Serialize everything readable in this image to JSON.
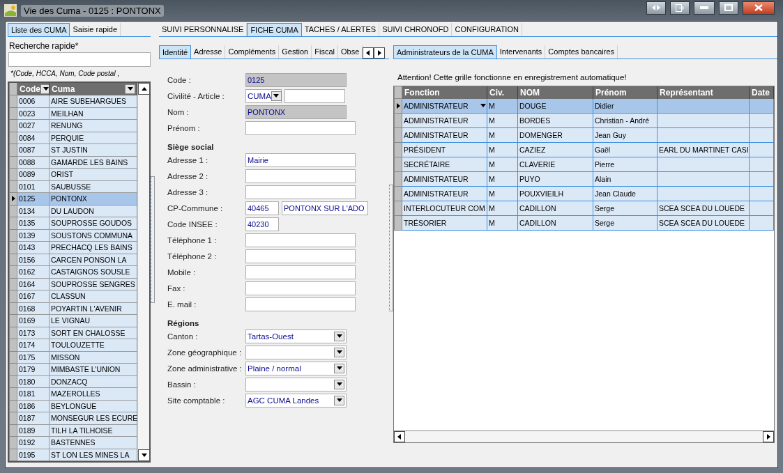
{
  "window": {
    "title": "Vie des Cuma - 0125 : PONTONX"
  },
  "left_tabs": [
    {
      "label": "Liste des CUMA",
      "selected": true
    },
    {
      "label": "Saisie rapide",
      "selected": false
    }
  ],
  "quick_search": {
    "label": "Recherche rapide*",
    "hint": "*(Code, HCCA, Nom, Code postal ,"
  },
  "cuma_list": {
    "columns": [
      "Code",
      "Cuma"
    ],
    "rows": [
      {
        "code": "0006",
        "name": "AIRE SUBEHARGUES",
        "selected": false
      },
      {
        "code": "0023",
        "name": "MEILHAN",
        "selected": false
      },
      {
        "code": "0027",
        "name": "RENUNG",
        "selected": false
      },
      {
        "code": "0084",
        "name": "PERQUIE",
        "selected": false
      },
      {
        "code": "0087",
        "name": "ST JUSTIN",
        "selected": false
      },
      {
        "code": "0088",
        "name": "GAMARDE LES BAINS",
        "selected": false
      },
      {
        "code": "0089",
        "name": "ORIST",
        "selected": false
      },
      {
        "code": "0101",
        "name": "SAUBUSSE",
        "selected": false
      },
      {
        "code": "0125",
        "name": "PONTONX",
        "selected": true
      },
      {
        "code": "0134",
        "name": "DU LAUDON",
        "selected": false
      },
      {
        "code": "0135",
        "name": "SOUPROSSE GOUDOS",
        "selected": false
      },
      {
        "code": "0139",
        "name": "SOUSTONS COMMUNA",
        "selected": false
      },
      {
        "code": "0143",
        "name": "PRECHACQ LES BAINS",
        "selected": false
      },
      {
        "code": "0156",
        "name": "CARCEN PONSON LA",
        "selected": false
      },
      {
        "code": "0162",
        "name": "CASTAIGNOS SOUSLE",
        "selected": false
      },
      {
        "code": "0164",
        "name": "SOUPROSSE SENGRES",
        "selected": false
      },
      {
        "code": "0167",
        "name": "CLASSUN",
        "selected": false
      },
      {
        "code": "0168",
        "name": "POYARTIN L'AVENIR",
        "selected": false
      },
      {
        "code": "0169",
        "name": "LE VIGNAU",
        "selected": false
      },
      {
        "code": "0173",
        "name": "SORT EN CHALOSSE",
        "selected": false
      },
      {
        "code": "0174",
        "name": "TOULOUZETTE",
        "selected": false
      },
      {
        "code": "0175",
        "name": "MISSON",
        "selected": false
      },
      {
        "code": "0179",
        "name": "MIMBASTE L'UNION",
        "selected": false
      },
      {
        "code": "0180",
        "name": "DONZACQ",
        "selected": false
      },
      {
        "code": "0181",
        "name": "MAZEROLLES",
        "selected": false
      },
      {
        "code": "0186",
        "name": "BEYLONGUE",
        "selected": false
      },
      {
        "code": "0187",
        "name": "MONSEGUR LES ECURE",
        "selected": false
      },
      {
        "code": "0189",
        "name": "TILH LA TILHOISE",
        "selected": false
      },
      {
        "code": "0192",
        "name": "BASTENNES",
        "selected": false
      },
      {
        "code": "0195",
        "name": "ST LON LES MINES LA",
        "selected": false
      }
    ]
  },
  "main_tabs": [
    {
      "label": "SUIVI PERSONNALISE",
      "selected": false
    },
    {
      "label": "FICHE CUMA",
      "selected": true
    },
    {
      "label": "TACHES / ALERTES",
      "selected": false
    },
    {
      "label": "SUIVI CHRONOFD",
      "selected": false
    },
    {
      "label": "CONFIGURATION",
      "selected": false
    }
  ],
  "form_tabs": [
    {
      "label": "Identité",
      "selected": true
    },
    {
      "label": "Adresse",
      "selected": false
    },
    {
      "label": "Compléments",
      "selected": false
    },
    {
      "label": "Gestion",
      "selected": false
    },
    {
      "label": "Fiscal",
      "selected": false
    },
    {
      "label": "Obse",
      "selected": false
    }
  ],
  "form": [
    {
      "kind": "readonly",
      "label": "Code :",
      "value": "0125"
    },
    {
      "kind": "article",
      "label": "Civilité - Article :",
      "value": "CUMA"
    },
    {
      "kind": "readonly",
      "label": "Nom :",
      "value": "PONTONX"
    },
    {
      "kind": "text",
      "label": "Prénom :"
    },
    {
      "kind": "heading",
      "label": "Siège social"
    },
    {
      "kind": "text",
      "label": "Adresse 1 :",
      "value": "Mairie"
    },
    {
      "kind": "text",
      "label": "Adresse 2 :"
    },
    {
      "kind": "text",
      "label": "Adresse 3 :"
    },
    {
      "kind": "pair",
      "label": "CP-Commune :",
      "value": "40465",
      "value2": "PONTONX SUR L'ADO"
    },
    {
      "kind": "short",
      "label": "Code INSEE :",
      "value": "40230"
    },
    {
      "kind": "text",
      "label": "Téléphone 1 :"
    },
    {
      "kind": "text",
      "label": "Téléphone 2 :"
    },
    {
      "kind": "text",
      "label": "Mobile :"
    },
    {
      "kind": "text",
      "label": "Fax :"
    },
    {
      "kind": "text",
      "label": "E. mail :"
    },
    {
      "kind": "heading",
      "label": "Régions"
    },
    {
      "kind": "combo",
      "label": "Canton :",
      "value": "Tartas-Ouest"
    },
    {
      "kind": "combo",
      "label": "Zone géographique :"
    },
    {
      "kind": "combo",
      "label": "Zone administrative :",
      "value": "Plaine / normal"
    },
    {
      "kind": "combo",
      "label": "Bassin :"
    },
    {
      "kind": "combo",
      "label": "Site comptable :",
      "value": "AGC CUMA Landes"
    }
  ],
  "right_tabs": [
    {
      "label": "Administrateurs de la CUMA",
      "selected": true
    },
    {
      "label": "Intervenants",
      "selected": false
    },
    {
      "label": "Comptes bancaires",
      "selected": false
    }
  ],
  "notice": "Attention! Cette grille fonctionne en enregistrement automatique!",
  "admins": {
    "columns": [
      "Fonction",
      "Civ.",
      "NOM",
      "Prénom",
      "Représentant",
      "Date"
    ],
    "rows": [
      {
        "cells": [
          "ADMINISTRATEUR",
          "M",
          "DOUGE",
          "Didier",
          ""
        ],
        "selected": true
      },
      {
        "cells": [
          "ADMINISTRATEUR",
          "M",
          "BORDES",
          "Christian - André",
          ""
        ],
        "selected": false
      },
      {
        "cells": [
          "ADMINISTRATEUR",
          "M",
          "DOMENGER",
          "Jean Guy",
          ""
        ],
        "selected": false
      },
      {
        "cells": [
          "PRÉSIDENT",
          "M",
          "CAZIEZ",
          "Gaël",
          "EARL DU MARTINET CASI"
        ],
        "selected": false
      },
      {
        "cells": [
          "SECRÉTAIRE",
          "M",
          "CLAVERIE",
          "Pierre",
          ""
        ],
        "selected": false
      },
      {
        "cells": [
          "ADMINISTRATEUR",
          "M",
          "PUYO",
          "Alain",
          ""
        ],
        "selected": false
      },
      {
        "cells": [
          "ADMINISTRATEUR",
          "M",
          "POUXVIEILH",
          "Jean Claude",
          ""
        ],
        "selected": false
      },
      {
        "cells": [
          "INTERLOCUTEUR COM",
          "M",
          "CADILLON",
          "Serge",
          "SCEA SCEA DU LOUEDE"
        ],
        "selected": false
      },
      {
        "cells": [
          "TRÉSORIER",
          "M",
          "CADILLON",
          "Serge",
          "SCEA SCEA DU LOUEDE"
        ],
        "selected": false
      }
    ]
  }
}
